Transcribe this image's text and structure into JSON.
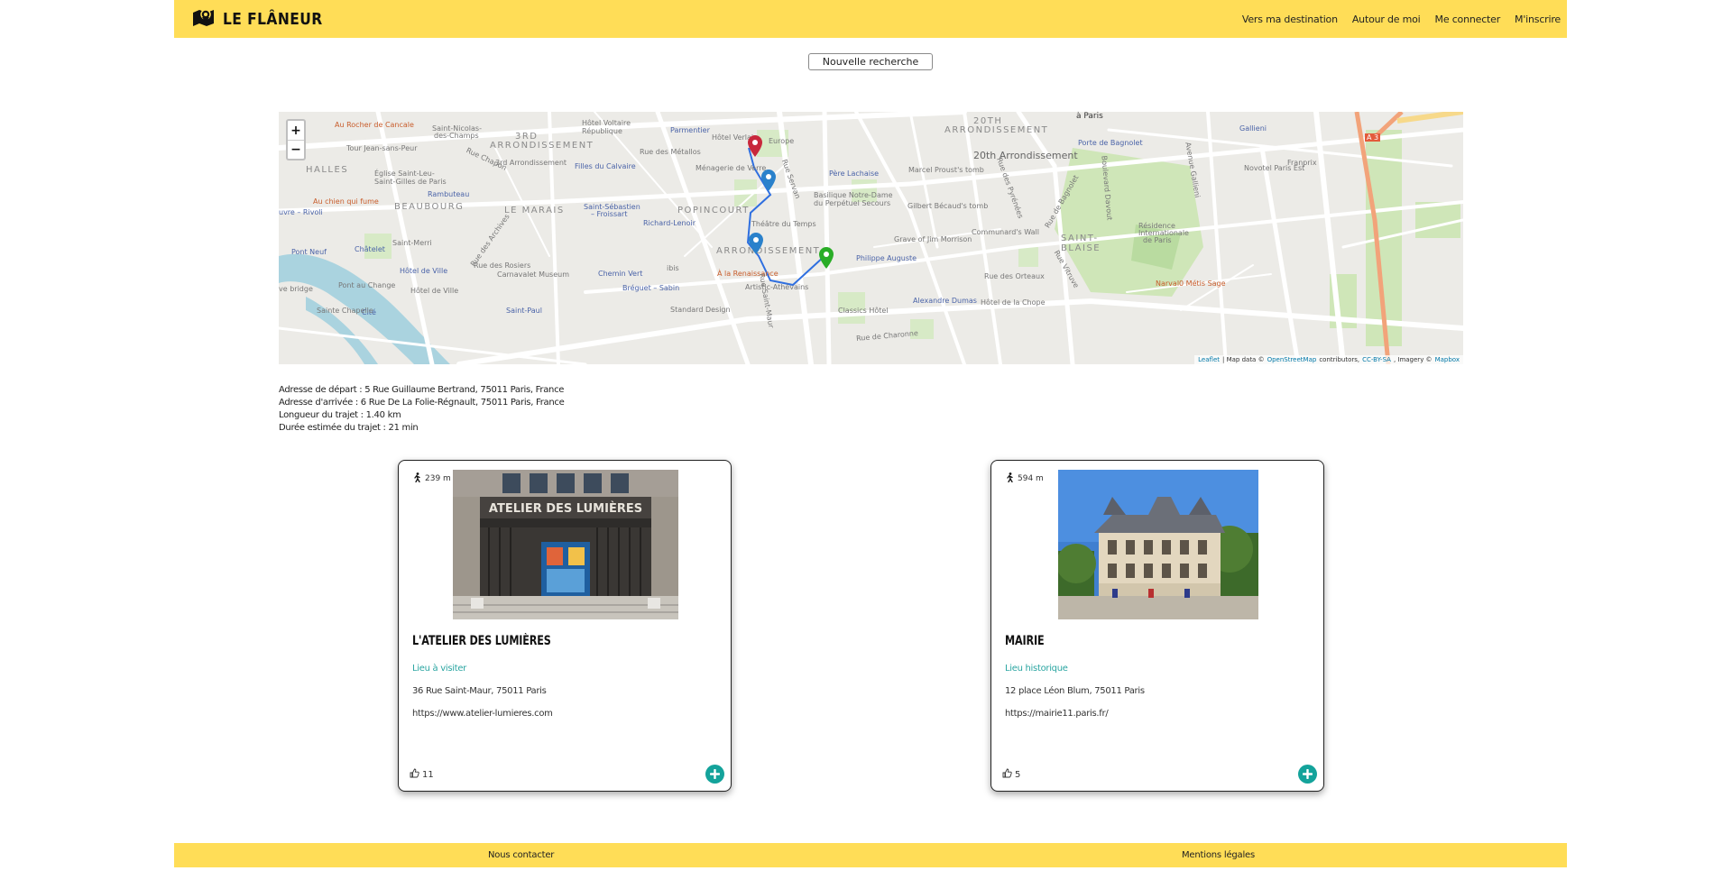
{
  "header": {
    "logo_text": "LE FLÂNEUR",
    "nav": [
      "Vers ma destination",
      "Autour de moi",
      "Me connecter",
      "M'inscrire"
    ]
  },
  "search": {
    "new_search_label": "Nouvelle recherche"
  },
  "map": {
    "zoom_in": "+",
    "zoom_out": "−",
    "attribution": {
      "leaflet": "Leaflet",
      "sep1": "| Map data ©",
      "osm": "OpenStreetMap",
      "contributors": "contributors,",
      "license": "CC-BY-SA",
      "imagery": ", Imagery ©",
      "mapbox": "Mapbox"
    },
    "labels": {
      "a_paris": "à Paris",
      "arr3": "3RD",
      "arr3b": "ARRONDISSEMENT",
      "arr20": "20TH",
      "arr20b": "ARRONDISSEMENT",
      "arr20c": "20th Arrondissement",
      "halles": "HALLES",
      "beaubourg": "BEAUBOURG",
      "marais": "LE MARAIS",
      "popincourt": "POPINCOURT",
      "arr11": "ARRONDISSEMENT",
      "saint_blaise": "SAINT-",
      "saint_blaise2": "BLAISE",
      "rocher": "Au Rocher de Cancale",
      "tour_jean": "Tour Jean-sans-Peur",
      "eglise": "Église Saint-Leu-",
      "eglise2": "Saint-Gilles de Paris",
      "chien": "Au chien qui fume",
      "rivoli": "uvre – Rivoli",
      "st_nicolas": "Saint-Nicolas-",
      "st_nicolas2": "des-Champs",
      "hotel_voltaire": "Hôtel Voltaire",
      "hotel_voltaire2": "République",
      "rue_chapon": "Rue Chapon",
      "arr3_mairie": "3rd Arrondissement",
      "rambuteau": "Rambuteau",
      "filles": "Filles du Calvaire",
      "st_sebastien": "Saint-Sébastien",
      "froissart": "– Froissart",
      "richard": "Richard-Lenoir",
      "parmentier": "Parmentier",
      "hotel_verlain": "Hôtel Verlain",
      "europe": "Europe",
      "metallos": "Rue des Métallos",
      "menagerie": "Ménagerie de Verre",
      "pere_lachaise": "Père Lachaise",
      "basilique": "Basilique Notre-Dame",
      "basilique2": "du Perpétuel Secours",
      "theatre": "Théâtre du Temps",
      "marcel": "Marcel Proust's tomb",
      "gilbert": "Gilbert Bécaud's tomb",
      "communard": "Communard's Wall",
      "jim": "Grave of Jim Morrison",
      "bagnolet": "Porte de Bagnolet",
      "gallieni": "Gallieni",
      "novotel": "Novotel Paris Est",
      "franprix": "Franprix",
      "residence": "Résidence",
      "residence2": "Internationale",
      "residence3": "de Paris",
      "narval": "Narval0 Métis Sage",
      "philippe": "Philippe Auguste",
      "alexandre": "Alexandre Dumas",
      "chope": "Hôtel de la Chope",
      "orteaux": "Rue des Orteaux",
      "renaissance": "À la Renaissance",
      "artistic": "Artistic-Athévains",
      "classics": "Classics Hôtel",
      "standard": "Standard Design",
      "bastille": "Bréguet – Sabin",
      "carnavalet": "Carnavalet Museum",
      "rosiers": "Rue des Rosiers",
      "chemin_vert": "Chemin Vert",
      "ibis": "ibis",
      "saint_paul": "Saint-Paul",
      "pont_neuf": "Pont Neuf",
      "chatelet": "Châtelet",
      "saint_merri": "Saint-Merri",
      "hotel_ville": "Hôtel de Ville",
      "hotel_ville2": "Hôtel de Ville",
      "pont_change": "Pont au Change",
      "cite": "Cité",
      "sainte_chapelle": "Sainte Chapelle",
      "archives": "Rue des Archives",
      "rue_saint_maur": "Rue Saint-Maur",
      "rue_servan": "Rue Servan",
      "bd_davout": "Boulevard Davout",
      "bd_bagnolet": "Rue de Bagnolet",
      "rue_pyrenees": "Rue des Pyrénées",
      "a3": "A 3",
      "ave_gallieni": "Avenue Gallieni",
      "rue_charonne": "Rue de Charonne",
      "rue_vitruve": "Rue Vitruve",
      "ve_bridge": "ve bridge"
    }
  },
  "trip": {
    "start": "Adresse de départ : 5 Rue Guillaume Bertrand, 75011 Paris, France",
    "end": "Adresse d'arrivée : 6 Rue De La Folie-Régnault, 75011 Paris, France",
    "length": "Longueur du trajet : 1.40 km",
    "duration": "Durée estimée du trajet : 21 min"
  },
  "places": [
    {
      "distance": "239 m",
      "name": "L'ATELIER DES LUMIÈRES",
      "category": "Lieu à visiter",
      "address": "36 Rue Saint-Maur, 75011 Paris",
      "website": "https://www.atelier-lumieres.com",
      "likes": "11",
      "photo_sign": "ATELIER DES LUMIÈRES"
    },
    {
      "distance": "594 m",
      "name": "MAIRIE",
      "category": "Lieu historique",
      "address": "12 place Léon Blum, 75011 Paris",
      "website": "https://mairie11.paris.fr/",
      "likes": "5"
    }
  ],
  "footer": {
    "contact": "Nous contacter",
    "legal": "Mentions légales"
  },
  "colors": {
    "brand_yellow": "#ffdd57",
    "accent_teal": "#14a39b",
    "route_blue": "#2f6fe0"
  }
}
